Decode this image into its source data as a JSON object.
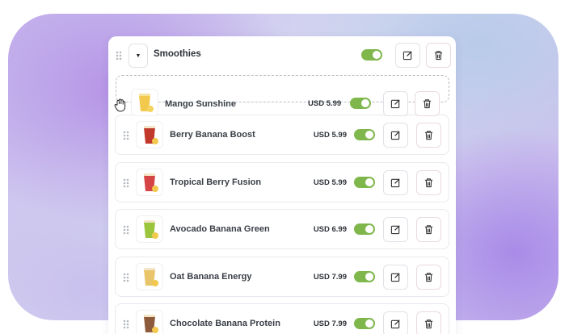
{
  "category": {
    "title": "Smoothies",
    "expanded_icon": "caret-down-icon",
    "enabled": true
  },
  "dragged_item": {
    "name": "Mango Sunshine",
    "price": "USD 5.99",
    "enabled": true,
    "image_color": "#f2c94c"
  },
  "items": [
    {
      "name": "Berry Banana Boost",
      "price": "USD 5.99",
      "enabled": true,
      "image_color": "#c0392b"
    },
    {
      "name": "Tropical Berry Fusion",
      "price": "USD 5.99",
      "enabled": true,
      "image_color": "#d64545"
    },
    {
      "name": "Avocado Banana Green",
      "price": "USD 6.99",
      "enabled": true,
      "image_color": "#9bc53d"
    },
    {
      "name": "Oat Banana Energy",
      "price": "USD 7.99",
      "enabled": true,
      "image_color": "#e8c46a"
    },
    {
      "name": "Chocolate Banana Protein",
      "price": "USD 7.99",
      "enabled": true,
      "image_color": "#8d5a3b"
    }
  ],
  "colors": {
    "toggle_on": "#7fb74c",
    "accent_background": "#b593e6"
  }
}
